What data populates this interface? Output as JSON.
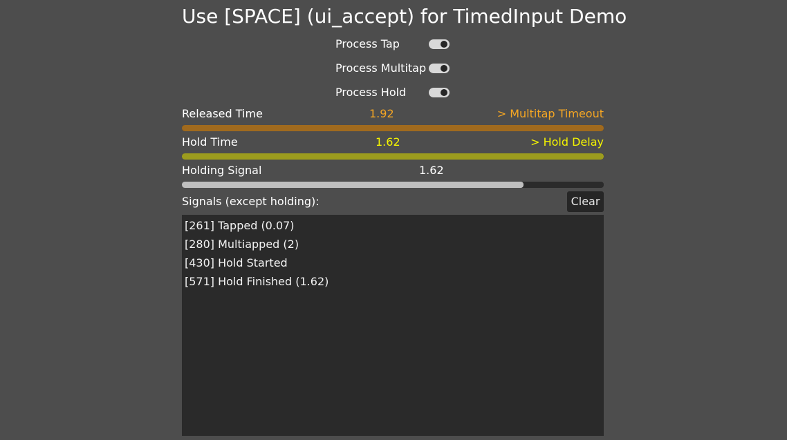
{
  "title": "Use [SPACE] (ui_accept) for TimedInput Demo",
  "toggles": [
    {
      "label": "Process Tap",
      "on": true
    },
    {
      "label": "Process Multitap",
      "on": true
    },
    {
      "label": "Process Hold",
      "on": true
    }
  ],
  "released": {
    "label": "Released Time",
    "value": "1.92",
    "status": "> Multitap Timeout",
    "progress": 1.0,
    "color": "#f5a623",
    "bar_color": "#a06a1e"
  },
  "hold": {
    "label": "Hold Time",
    "value": "1.62",
    "status": "> Hold Delay",
    "progress": 1.0,
    "color": "#f5f500",
    "bar_color": "#9c9c1e"
  },
  "holding_signal": {
    "label": "Holding Signal",
    "value": "1.62",
    "progress": 0.81,
    "bar_color": "#bfbfbf"
  },
  "signals": {
    "label": "Signals (except holding):",
    "clear_label": "Clear",
    "lines": [
      "[261] Tapped (0.07)",
      "[280] Multiapped (2)",
      "[430] Hold Started",
      "[571] Hold Finished (1.62)"
    ]
  }
}
